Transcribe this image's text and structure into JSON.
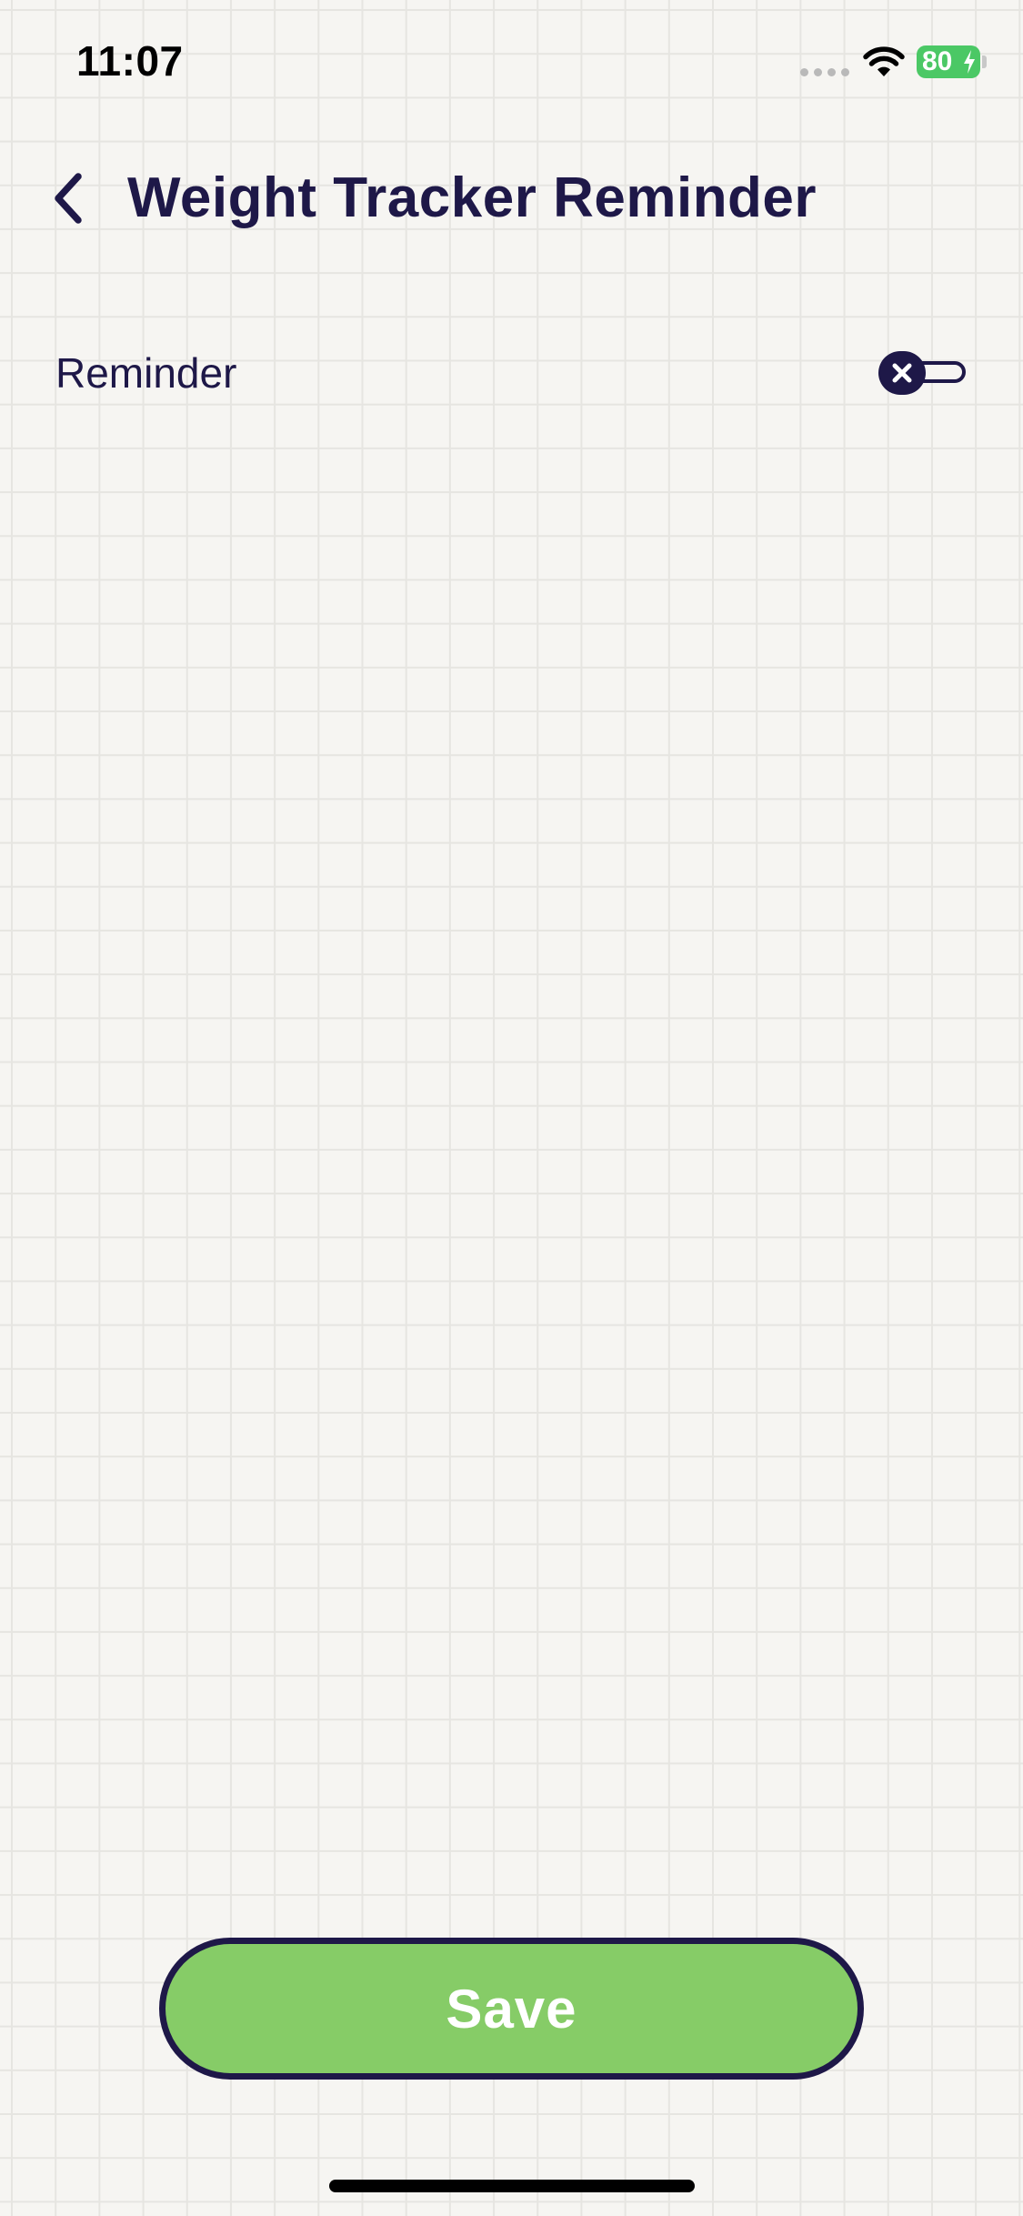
{
  "status_bar": {
    "time": "11:07",
    "battery_level": "80",
    "battery_charging": true,
    "icons": [
      "cellular-signal-icon",
      "wifi-icon",
      "battery-icon"
    ]
  },
  "header": {
    "back_icon": "chevron-left-icon",
    "title": "Weight Tracker Reminder"
  },
  "settings": {
    "reminder": {
      "label": "Reminder",
      "enabled": false,
      "toggle_icon": "close-icon"
    }
  },
  "footer": {
    "save_label": "Save"
  },
  "colors": {
    "background": "#f6f5f2",
    "grid_line": "#e6e5e1",
    "primary_text": "#1e1848",
    "save_button": "#86cc67",
    "battery": "#4bc865"
  }
}
